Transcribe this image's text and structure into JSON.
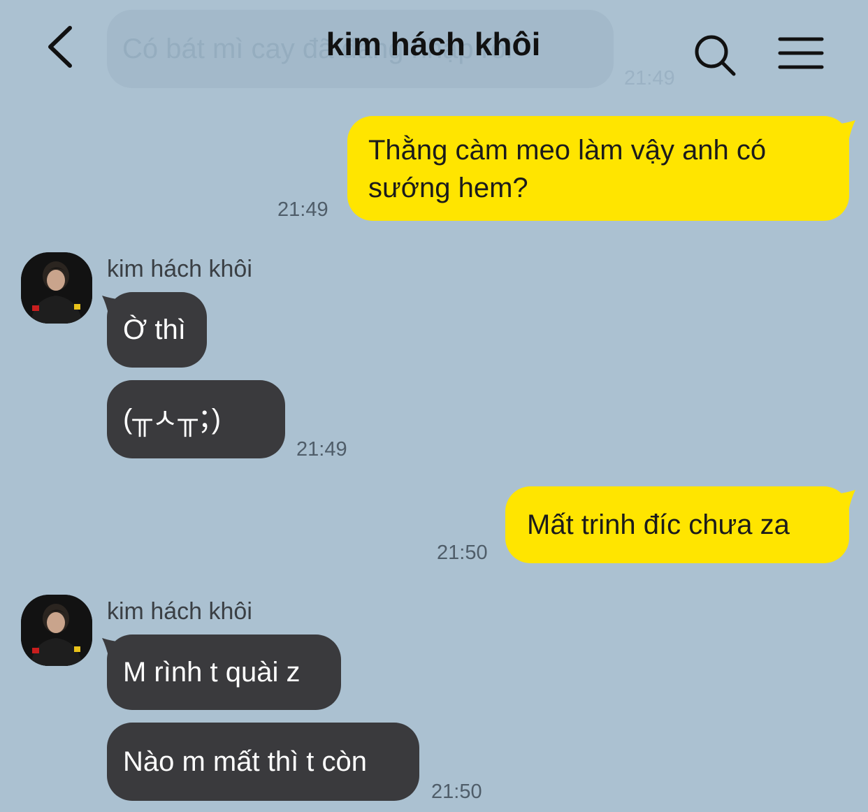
{
  "header": {
    "title": "kim hách khôi",
    "ghost_text": "Có bát mì cay đã đăng nhập rồi",
    "ghost_time": "21:49"
  },
  "messages": [
    {
      "from": "me",
      "text_lines": [
        "Thằng càm meo làm vậy anh có",
        "sướng hem?"
      ],
      "time": "21:49"
    },
    {
      "from": "them",
      "sender": "kim hách khôi",
      "text": "Ờ thì"
    },
    {
      "from": "them",
      "text": "(╥ㅅ╥；)",
      "time": "21:49"
    },
    {
      "from": "me",
      "text": "Mất trinh đíc chưa za",
      "time": "21:50"
    },
    {
      "from": "them",
      "sender": "kim hách khôi",
      "text": "M rình t quài z"
    },
    {
      "from": "them",
      "text": "Nào m mất thì t còn",
      "time": "21:50"
    }
  ],
  "colors": {
    "background": "#abc1d1",
    "my_bubble": "#ffe500",
    "their_bubble": "#3a3a3d"
  },
  "icons": [
    "back-chevron-icon",
    "search-icon",
    "menu-icon"
  ]
}
